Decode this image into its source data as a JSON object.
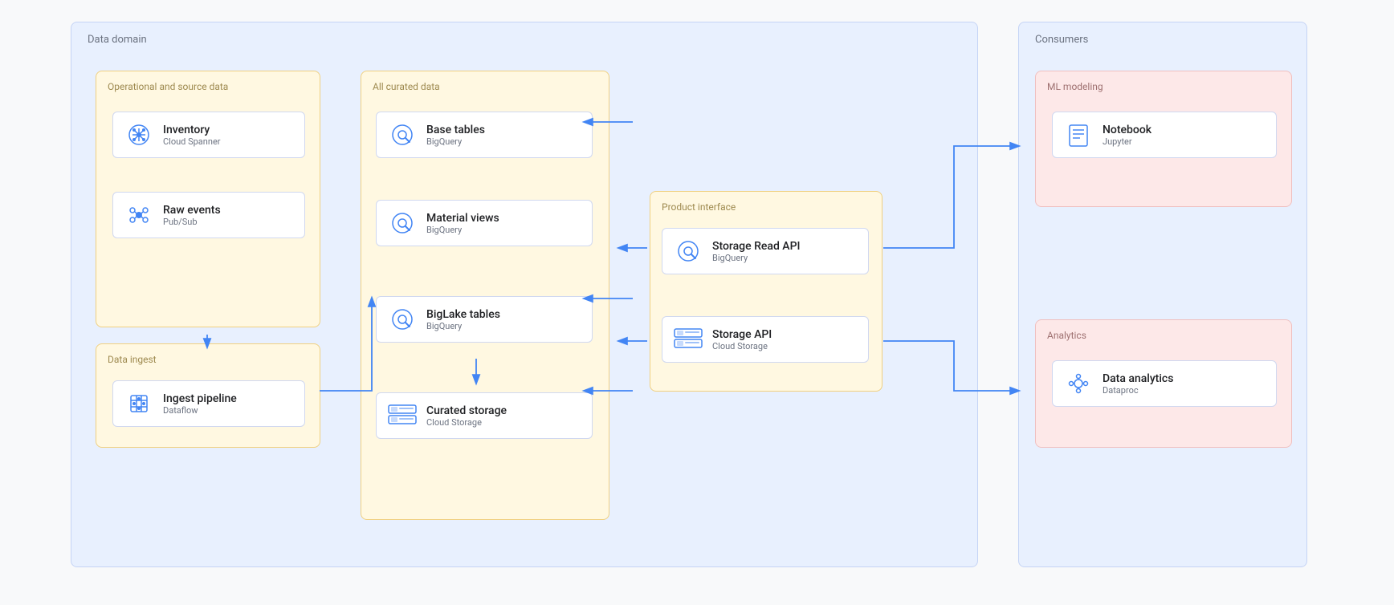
{
  "diagram": {
    "dataDomain": {
      "label": "Data domain",
      "sections": {
        "operational": {
          "label": "Operational and source data",
          "cards": [
            {
              "id": "inventory",
              "title": "Inventory",
              "subtitle": "Cloud Spanner"
            },
            {
              "id": "raw-events",
              "title": "Raw events",
              "subtitle": "Pub/Sub"
            }
          ]
        },
        "dataIngest": {
          "label": "Data ingest",
          "cards": [
            {
              "id": "ingest-pipeline",
              "title": "Ingest pipeline",
              "subtitle": "Dataflow"
            }
          ]
        },
        "allCurated": {
          "label": "All curated data",
          "cards": [
            {
              "id": "base-tables",
              "title": "Base tables",
              "subtitle": "BigQuery"
            },
            {
              "id": "material-views",
              "title": "Material  views",
              "subtitle": "BigQuery"
            },
            {
              "id": "biglake-tables",
              "title": "BigLake tables",
              "subtitle": "BigQuery"
            },
            {
              "id": "curated-storage",
              "title": "Curated storage",
              "subtitle": "Cloud Storage"
            }
          ]
        },
        "productInterface": {
          "label": "Product interface",
          "cards": [
            {
              "id": "storage-read-api",
              "title": "Storage Read API",
              "subtitle": "BigQuery"
            },
            {
              "id": "storage-api",
              "title": "Storage API",
              "subtitle": "Cloud Storage"
            }
          ]
        }
      }
    },
    "consumers": {
      "label": "Consumers",
      "sections": {
        "mlModeling": {
          "label": "ML modeling",
          "cards": [
            {
              "id": "notebook",
              "title": "Notebook",
              "subtitle": "Jupyter"
            }
          ]
        },
        "analytics": {
          "label": "Analytics",
          "cards": [
            {
              "id": "data-analytics",
              "title": "Data analytics",
              "subtitle": "Dataproc"
            }
          ]
        }
      }
    }
  }
}
